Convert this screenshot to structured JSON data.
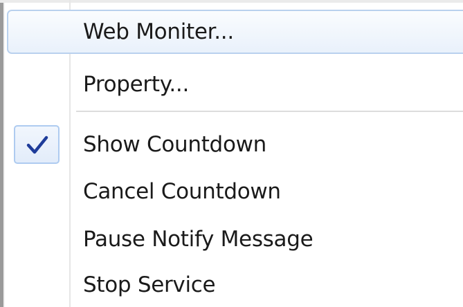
{
  "menu": {
    "items": [
      {
        "label": "Web Moniter...",
        "highlighted": true
      },
      {
        "label": "Property..."
      },
      {
        "label": "Show Countdown",
        "checked": true,
        "check_icon": "checkmark-icon"
      },
      {
        "label": "Cancel Countdown"
      },
      {
        "label": "Pause Notify Message"
      },
      {
        "label": "Stop Service"
      }
    ]
  },
  "colors": {
    "highlight_border": "#b9d1ee",
    "check_color": "#1e3c9a",
    "text": "#1a1a1a"
  }
}
